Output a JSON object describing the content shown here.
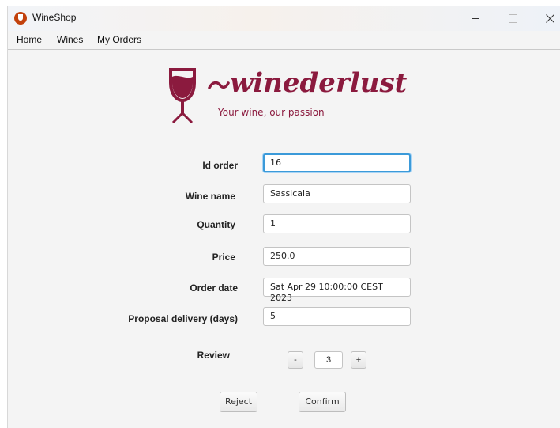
{
  "window": {
    "title": "WineShop"
  },
  "menu": {
    "items": [
      "Home",
      "Wines",
      "My Orders"
    ]
  },
  "banner": {
    "brand": "winederlust",
    "tagline": "Your wine, our passion"
  },
  "form": {
    "id_order": {
      "label": "Id order",
      "value": "16"
    },
    "wine_name": {
      "label": "Wine name",
      "value": "Sassicaia"
    },
    "quantity": {
      "label": "Quantity",
      "value": "1"
    },
    "price": {
      "label": "Price",
      "value": "250.0"
    },
    "order_date": {
      "label": "Order date",
      "value": "Sat Apr 29 10:00:00 CEST 2023"
    },
    "proposal_delivery": {
      "label": "Proposal delivery (days)",
      "value": "5"
    },
    "review": {
      "label": "Review",
      "value": "3",
      "decrement": "-",
      "increment": "+"
    }
  },
  "actions": {
    "reject": "Reject",
    "confirm": "Confirm"
  },
  "colors": {
    "brand": "#8b1a3e",
    "focus": "#3b9ad9"
  },
  "icons": {
    "app": "wine-icon",
    "minimize": "minimize-icon",
    "maximize": "maximize-icon",
    "close": "close-icon"
  }
}
